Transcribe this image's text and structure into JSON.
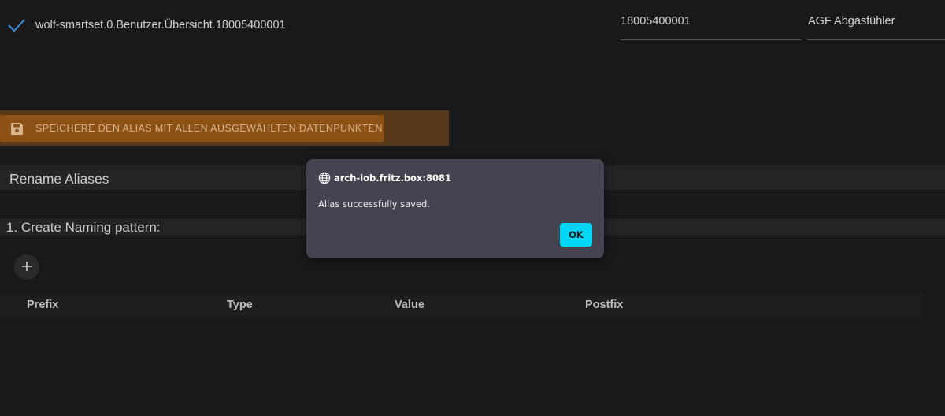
{
  "datapoint": {
    "path": "wolf-smartset.0.Benutzer.Übersicht.18005400001",
    "id_value": "18005400001",
    "name_value": "AGF Abgasfühler",
    "check_icon": "check-icon"
  },
  "save": {
    "label": "SPEICHERE DEN ALIAS MIT ALLEN AUSGEWÄHLTEN DATENPUNKTEN",
    "icon": "save-icon"
  },
  "rename": {
    "title": "Rename Aliases",
    "step1": "1. Create Naming pattern:",
    "add_icon": "plus-icon",
    "columns": [
      "Prefix",
      "Type",
      "Value",
      "Postfix"
    ]
  },
  "dialog": {
    "origin": "arch-iob.fritz.box:8081",
    "message": "Alias successfully saved.",
    "ok_label": "OK",
    "origin_icon": "globe-icon"
  },
  "colors": {
    "background": "#19191b",
    "save_button": "#8c5114",
    "save_bar": "#58391a",
    "accent_check": "#3a8fd9",
    "ok_button": "#00d6f5",
    "dialog_bg": "#45434f"
  }
}
